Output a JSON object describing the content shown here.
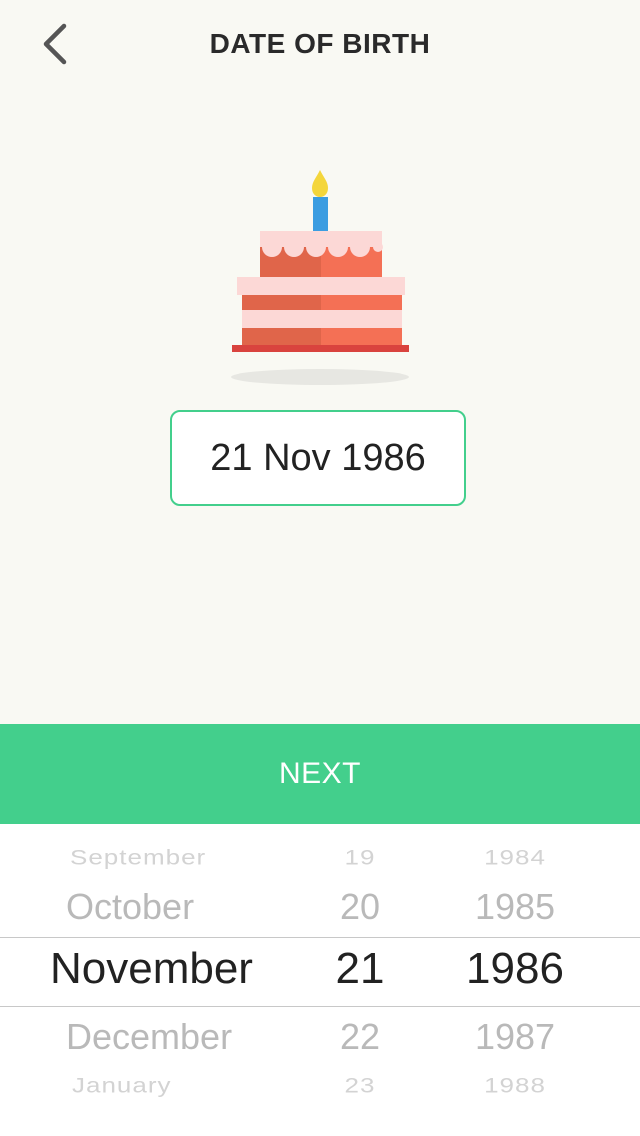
{
  "header": {
    "title": "DATE OF BIRTH",
    "back_icon": "chevron-left-icon"
  },
  "illustration": {
    "icon": "birthday-cake-icon"
  },
  "selected_date": "21 Nov 1986",
  "next_button": {
    "label": "NEXT"
  },
  "picker": {
    "months": [
      "September",
      "October",
      "November",
      "December",
      "January"
    ],
    "days": [
      "19",
      "20",
      "21",
      "22",
      "23"
    ],
    "years": [
      "1984",
      "1985",
      "1986",
      "1987",
      "1988"
    ],
    "selected_index": 2
  },
  "colors": {
    "accent": "#43cf8c",
    "background": "#f9f9f3",
    "text": "#222222"
  }
}
